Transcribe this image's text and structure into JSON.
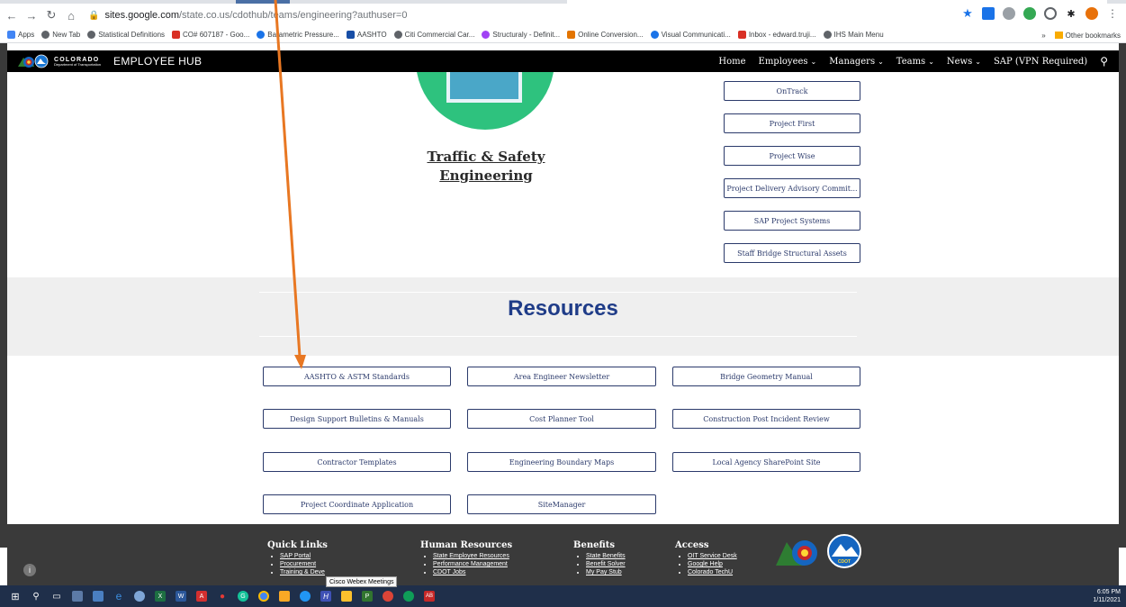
{
  "browser": {
    "url_host": "sites.google.com",
    "url_path": "/state.co.us/cdothub/teams/engineering?authuser=0",
    "bookmarks": [
      {
        "label": "Apps",
        "color": "#4285f4"
      },
      {
        "label": "New Tab",
        "color": "#5f6368"
      },
      {
        "label": "Statistical Definitions",
        "color": "#5f6368"
      },
      {
        "label": "CO# 607187 - Goo...",
        "color": "#d93025"
      },
      {
        "label": "Barametric Pressure...",
        "color": "#1a73e8"
      },
      {
        "label": "AASHTO",
        "color": "#174ea6"
      },
      {
        "label": "Citi Commercial Car...",
        "color": "#5f6368"
      },
      {
        "label": "Structuraly - Definit...",
        "color": "#a142f4"
      },
      {
        "label": "Online Conversion...",
        "color": "#e37400"
      },
      {
        "label": "Visual Communicati...",
        "color": "#1a73e8"
      },
      {
        "label": "Inbox - edward.truji...",
        "color": "#d93025"
      },
      {
        "label": "IHS Main Menu",
        "color": "#5f6368"
      }
    ],
    "more_bookmarks": "»",
    "other_bookmarks": "Other bookmarks"
  },
  "site": {
    "logo_line1": "COLORADO",
    "logo_line2": "Department of Transportation",
    "title": "EMPLOYEE HUB",
    "nav": [
      {
        "label": "Home",
        "chevron": false
      },
      {
        "label": "Employees",
        "chevron": true
      },
      {
        "label": "Managers",
        "chevron": true
      },
      {
        "label": "Teams",
        "chevron": true
      },
      {
        "label": "News",
        "chevron": true
      },
      {
        "label": "SAP (VPN Required)",
        "chevron": false
      }
    ]
  },
  "team": {
    "title_line1": "Traffic & Safety",
    "title_line2": "Engineering"
  },
  "team_links": [
    "OnTrack",
    "Project First",
    "Project Wise",
    "Project Delivery Advisory Commit...",
    "SAP Project Systems",
    "Staff Bridge Structural Assets"
  ],
  "resources": {
    "title": "Resources",
    "links": [
      "AASHTO & ASTM Standards",
      "Area Engineer Newsletter",
      "Bridge Geometry Manual",
      "Design Support Bulletins & Manuals",
      "Cost Planner Tool",
      "Construction Post Incident Review",
      "Contractor Templates",
      "Engineering Boundary Maps",
      "Local Agency SharePoint Site",
      "Project Coordinate Application",
      "SiteManager"
    ]
  },
  "footer": {
    "columns": [
      {
        "title": "Quick Links",
        "items": [
          "SAP Portal",
          "Procurement",
          "Training & Deve"
        ]
      },
      {
        "title": "Human Resources",
        "items": [
          "State Employee Resources",
          "Performance Management",
          "CDOT Jobs"
        ]
      },
      {
        "title": "Benefits",
        "items": [
          "State Benefits",
          "Benefit Solver",
          "My Pay Stub"
        ]
      },
      {
        "title": "Access",
        "items": [
          "OIT Service Desk",
          "Google Help",
          "Colorado TechU"
        ]
      }
    ],
    "badge_text": "CDOT"
  },
  "tooltip": "Cisco Webex Meetings",
  "taskbar": {
    "time": "6:05 PM",
    "date": "1/11/2021"
  }
}
